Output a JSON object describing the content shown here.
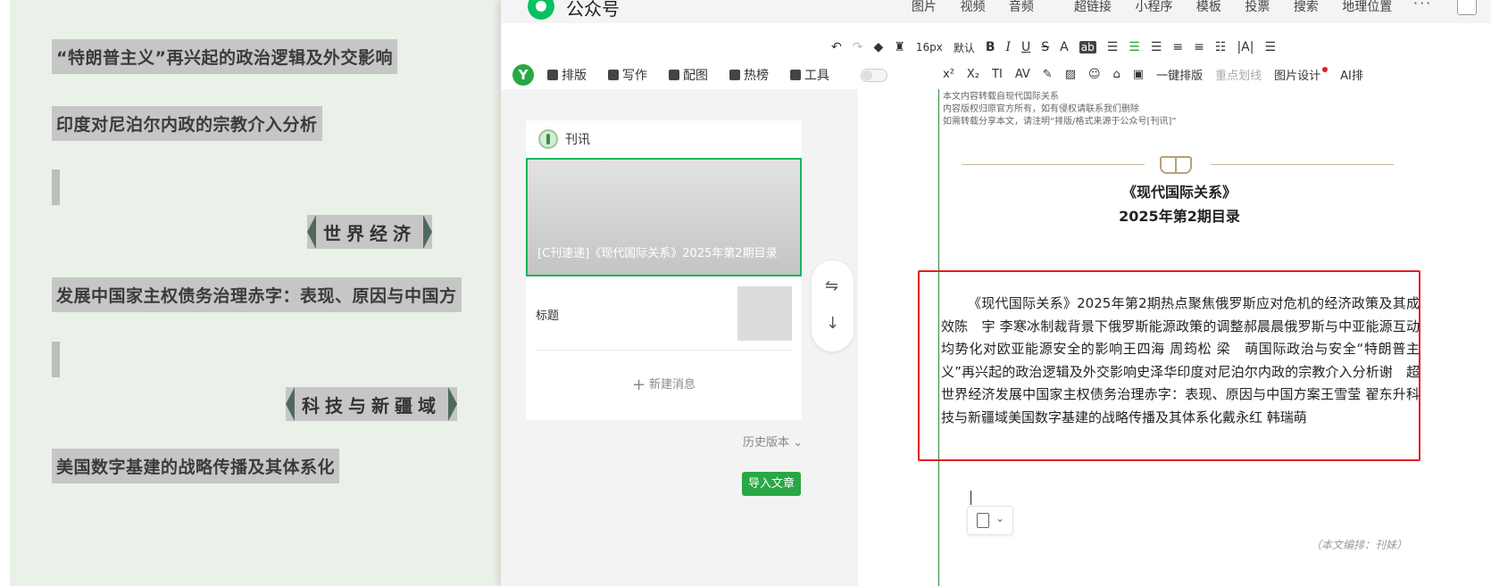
{
  "background_article": {
    "headlines": [
      "“特朗普主义”再兴起的政治逻辑及外交影响",
      "印度对尼泊尔内政的宗教介入分析",
      "发展中国家主权债务治理赤字：表现、原因与中国方",
      "美国数字基建的战略传播及其体系化"
    ],
    "sections": [
      "世界经济",
      "科技与新疆域"
    ]
  },
  "app": {
    "title": "公众号",
    "top_menu_insert": [
      "图片",
      "视频",
      "音频"
    ],
    "top_menu_tools": [
      "超链接",
      "小程序",
      "模板",
      "投票",
      "搜索",
      "地理位置"
    ],
    "more": "···"
  },
  "format_toolbar": {
    "font_size": "16px",
    "font_default": "默认",
    "bold": "B",
    "italic": "I",
    "underline": "U",
    "strike": "S",
    "font_color": "A",
    "bg_color": "ab"
  },
  "tools": {
    "layout": "排版",
    "write": "写作",
    "illustrate": "配图",
    "trending": "热榜",
    "toolbox": "工具"
  },
  "format_toolbar2": {
    "one_click_layout": "一键排版",
    "key_points": "重点划线",
    "image_design": "图片设计",
    "ai": "AI排"
  },
  "side_panel": {
    "account_name": "刊讯",
    "cover_title": "[C刊速递]《现代国际关系》2025年第2期目录",
    "item2_label": "标题",
    "new_message": "新建消息",
    "history": "历史版本",
    "import_button": "导入文章"
  },
  "content": {
    "meta_lines": [
      "本文内容转载自现代国际关系",
      "内容版权归原官方所有，如有侵权请联系我们删除",
      "如需转载分享本文，请注明“排版/格式来源于公众号[刊讯]”"
    ],
    "title_line1": "《现代国际关系》",
    "title_line2": "2025年第2期目录",
    "body": "《现代国际关系》2025年第2期热点聚焦俄罗斯应对危机的经济政策及其成效陈　宇 李寒冰制裁背景下俄罗斯能源政策的调整郝晨晨俄罗斯与中亚能源互动均势化对欧亚能源安全的影响王四海 周筠松 梁　萌国际政治与安全“特朗普主义”再兴起的政治逻辑及外交影响史泽华印度对尼泊尔内政的宗教介入分析谢　超世界经济发展中国家主权债务治理赤字：表现、原因与中国方案王雪莹 翟东升科技与新疆域美国数字基建的战略传播及其体系化戴永红 韩瑞萌",
    "editor_credit": "（本文编排：刊妹）"
  },
  "colors": {
    "brand_green": "#29a744",
    "highlight_red": "#e01e1e",
    "section_dark": "#4f6a5d"
  }
}
